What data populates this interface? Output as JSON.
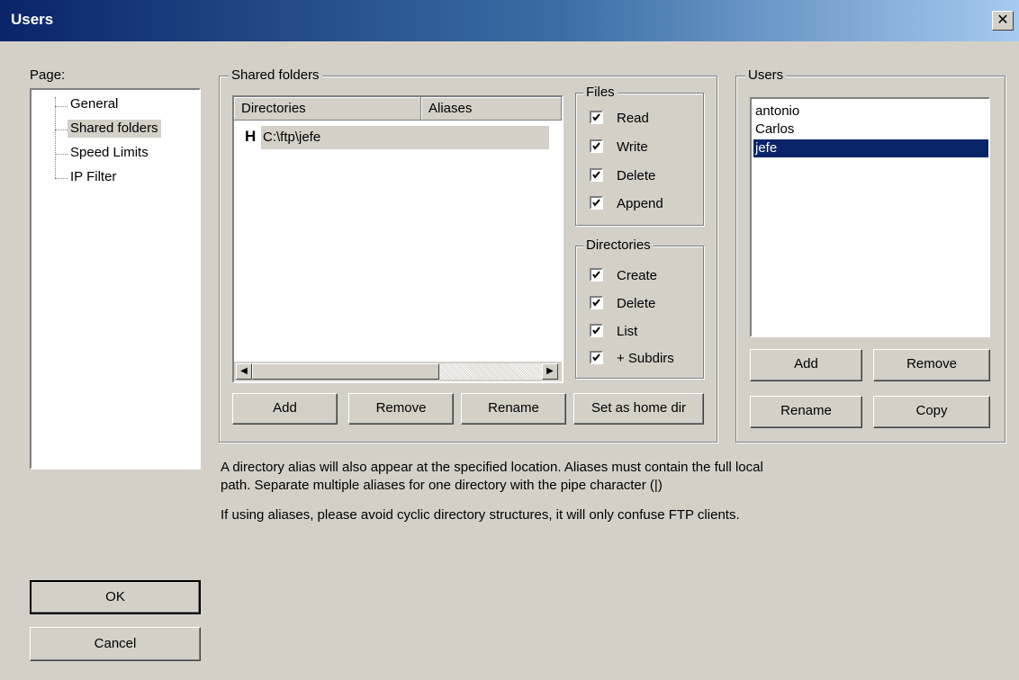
{
  "window": {
    "title": "Users",
    "close_glyph": "✕"
  },
  "page_label": "Page:",
  "tree": [
    "General",
    "Shared folders",
    "Speed Limits",
    "IP Filter"
  ],
  "shared": {
    "legend": "Shared folders",
    "columns": [
      "Directories",
      "Aliases"
    ],
    "rows": [
      {
        "flag": "H",
        "directory": "C:\\ftp\\jefe",
        "alias": ""
      }
    ],
    "buttons": {
      "add": "Add",
      "remove": "Remove",
      "rename": "Rename",
      "home": "Set as home dir"
    }
  },
  "files": {
    "legend": "Files",
    "items": [
      "Read",
      "Write",
      "Delete",
      "Append"
    ],
    "checked": [
      true,
      true,
      true,
      true
    ]
  },
  "directories": {
    "legend": "Directories",
    "items": [
      "Create",
      "Delete",
      "List",
      "+ Subdirs"
    ],
    "checked": [
      true,
      true,
      true,
      true
    ]
  },
  "users": {
    "legend": "Users",
    "list": [
      "antonio",
      "Carlos",
      "jefe"
    ],
    "selected": "jefe",
    "buttons": {
      "add": "Add",
      "remove": "Remove",
      "rename": "Rename",
      "copy": "Copy"
    }
  },
  "notes": {
    "line1": "A directory alias will also appear at the specified location. Aliases must contain the full local",
    "line2": "path. Separate multiple aliases for one directory with the pipe character (|)",
    "line3": "If using aliases, please avoid cyclic directory structures, it will only confuse FTP clients."
  },
  "footer": {
    "ok": "OK",
    "cancel": "Cancel"
  },
  "colors": {
    "selection": "#0a246a",
    "face": "#d4d0c8",
    "title_start": "#0a246a",
    "title_end": "#a6caf0"
  },
  "icons": [
    "close-icon",
    "scroll-left-icon",
    "scroll-right-icon",
    "checkmark-icon"
  ]
}
